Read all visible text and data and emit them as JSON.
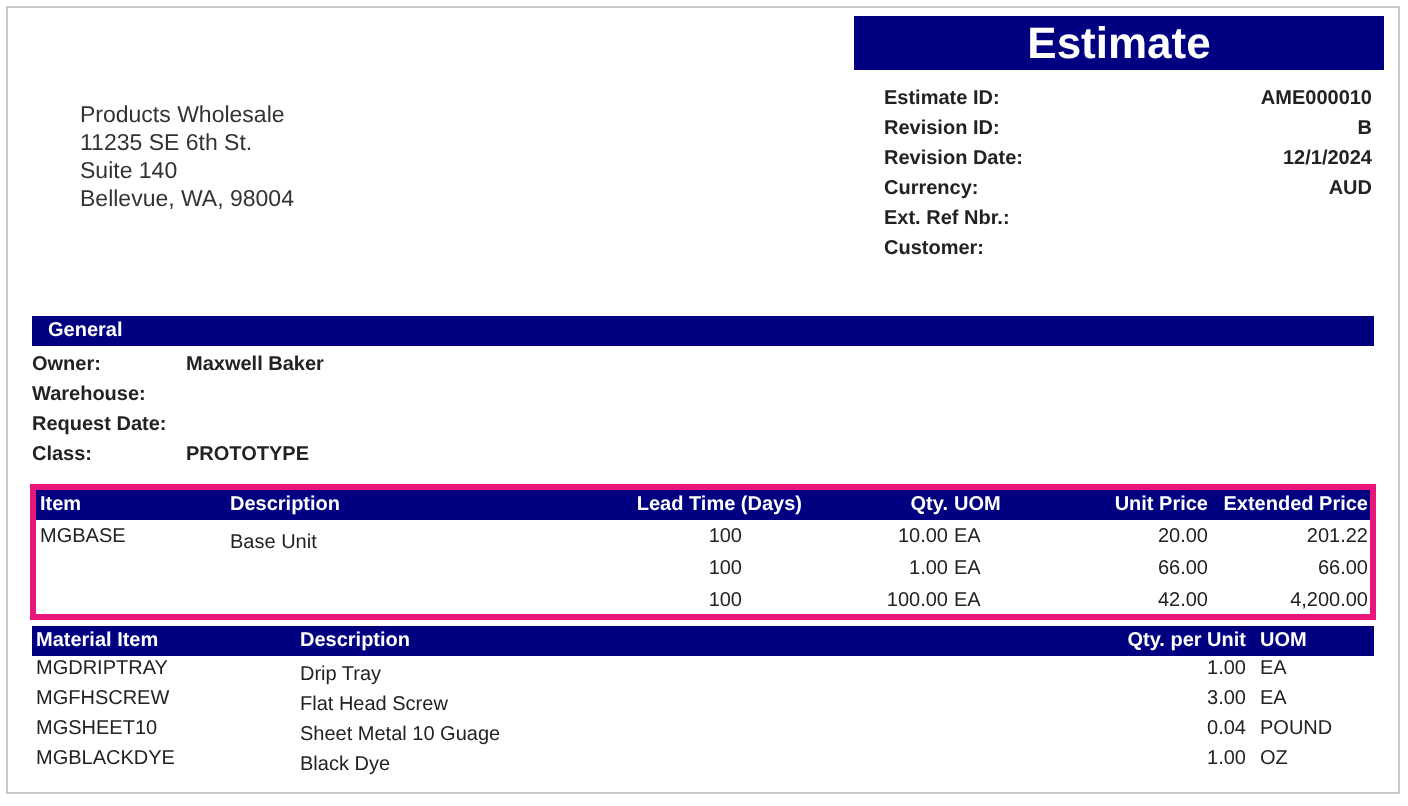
{
  "title": "Estimate",
  "address": [
    "Products Wholesale",
    "11235 SE 6th St.",
    "Suite 140",
    "Bellevue, WA, 98004"
  ],
  "info": [
    {
      "label": "Estimate ID:",
      "value": "AME000010"
    },
    {
      "label": "Revision ID:",
      "value": "B"
    },
    {
      "label": "Revision Date:",
      "value": "12/1/2024"
    },
    {
      "label": "Currency:",
      "value": "AUD"
    },
    {
      "label": "Ext. Ref Nbr.:"
    },
    {
      "label": "Customer:"
    }
  ],
  "general": {
    "title": "General",
    "fields": [
      {
        "label": "Owner:",
        "value": "Maxwell Baker"
      },
      {
        "label": "Warehouse:"
      },
      {
        "label": "Request Date:"
      },
      {
        "label": "Class:",
        "value": "PROTOTYPE"
      }
    ]
  },
  "items": {
    "columns": [
      "Item",
      "Description",
      "Lead Time (Days)",
      "Qty.",
      "UOM",
      "Unit Price",
      "Extended Price"
    ],
    "rows": [
      [
        "MGBASE",
        "Base Unit",
        "100",
        "10.00",
        "EA",
        "20.00",
        "201.22"
      ],
      [
        "",
        "",
        "100",
        "1.00",
        "EA",
        "66.00",
        "66.00"
      ],
      [
        "",
        "",
        "100",
        "100.00",
        "EA",
        "42.00",
        "4,200.00"
      ]
    ]
  },
  "materials": {
    "columns": [
      "Material Item",
      "Description",
      "Qty. per Unit",
      "UOM"
    ],
    "rows": [
      [
        "MGDRIPTRAY",
        "Drip Tray",
        "1.00",
        "EA"
      ],
      [
        "MGFHSCREW",
        "Flat Head Screw",
        "3.00",
        "EA"
      ],
      [
        "MGSHEET10",
        "Sheet Metal 10 Guage",
        "0.04",
        "POUND"
      ],
      [
        "MGBLACKDYE",
        "Black Dye",
        "1.00",
        "OZ"
      ]
    ]
  }
}
